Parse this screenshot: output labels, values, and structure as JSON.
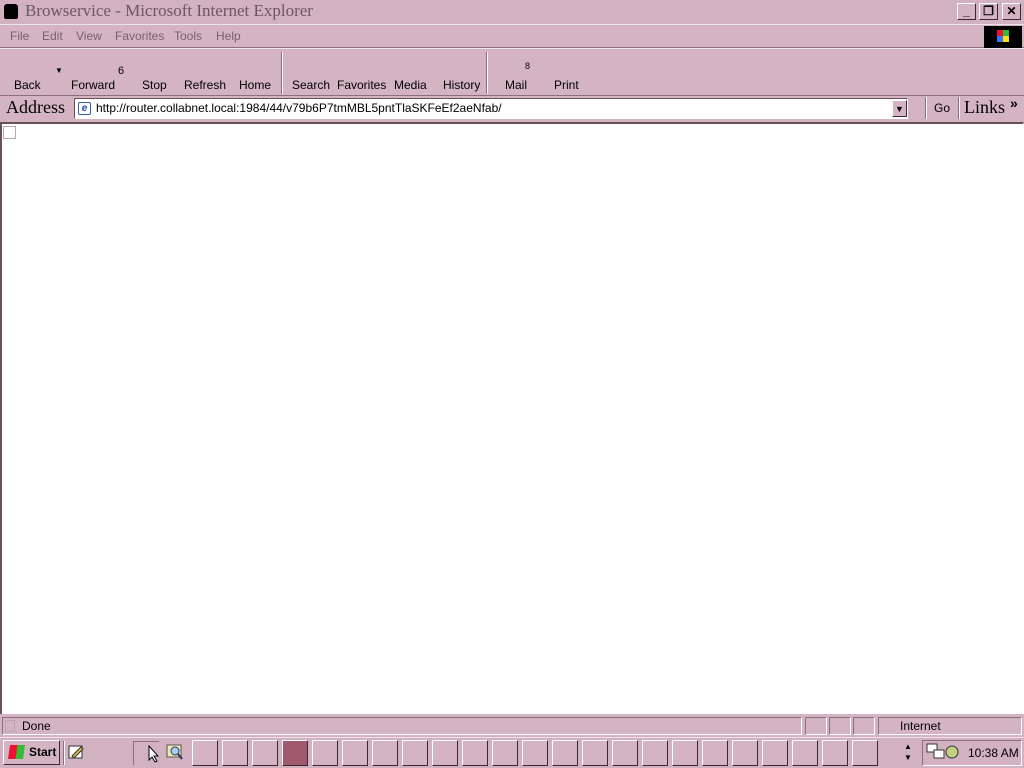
{
  "window": {
    "title": "Browservice - Microsoft Internet Explorer"
  },
  "menu": [
    {
      "label": "File"
    },
    {
      "label": "Edit"
    },
    {
      "label": "View"
    },
    {
      "label": "Favorites"
    },
    {
      "label": "Tools"
    },
    {
      "label": "Help"
    }
  ],
  "toolbar": {
    "back": "Back",
    "forward": "Forward",
    "forward_badge": "6",
    "stop": "Stop",
    "refresh": "Refresh",
    "home": "Home",
    "search": "Search",
    "favorites": "Favorites",
    "media": "Media",
    "history": "History",
    "mail": "Mail",
    "mail_badge": "8",
    "print": "Print"
  },
  "address": {
    "label": "Address",
    "url": "http://router.collabnet.local:1984/44/v79b6P7tmMBL5pntTlaSKFeEf2aeNfab/",
    "go": "Go",
    "links": "Links",
    "links_chevron": "»"
  },
  "status": {
    "text": "Done",
    "zone": "Internet"
  },
  "taskbar": {
    "start_label": "Start",
    "clock": "10:38 AM"
  },
  "colors": {
    "chrome": "#d4b4c2",
    "active_task": "#a05a6c"
  }
}
